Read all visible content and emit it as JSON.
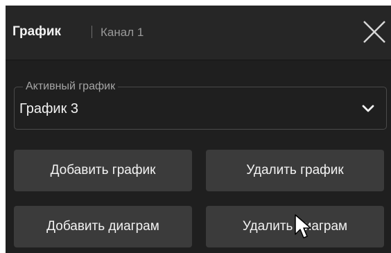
{
  "header": {
    "title": "График",
    "subtitle": "Канал 1"
  },
  "active_trace": {
    "label": "Активный график",
    "value": "График 3"
  },
  "buttons": {
    "add_trace": "Добавить график",
    "delete_trace": "Удалить график",
    "add_diagram": "Добавить диаграм",
    "delete_diagram": "Удалить диаграм"
  },
  "icons": {
    "close": "close-icon",
    "dropdown": "chevron-down-icon",
    "cursor": "mouse-pointer-icon"
  },
  "colors": {
    "panel_bg": "#1f1f1f",
    "header_bg": "#262626",
    "button_bg": "#3b3b3b",
    "text": "#f2f2f2",
    "muted_text": "#9a9a9a"
  }
}
